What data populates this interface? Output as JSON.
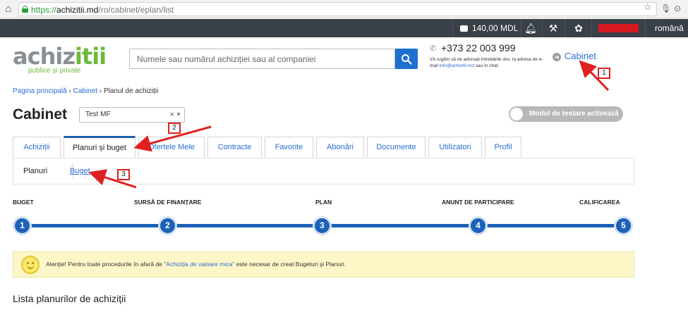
{
  "browser": {
    "url_scheme": "https://",
    "url_host": "achizitii.md",
    "url_path": "/ro/cabinet/eplan/list"
  },
  "topbar": {
    "balance": "140,00 MDL",
    "language": "română",
    "bg_color": "#3a4047"
  },
  "header": {
    "logo_part1": "achiz",
    "logo_part2": "itii",
    "logo_tagline": "publice și private",
    "search_placeholder": "Numele sau numărul achiziției sau al companiei",
    "phone": "+373 22 003 999",
    "contact_note_1": "Vă rugăm să ne adresați întrebările dvs. la adresa de e-mail ",
    "contact_email": "info@achizitii.md",
    "contact_note_2": " sau în chat.",
    "cabinet_link": "Cabinet"
  },
  "breadcrumb": {
    "home": "Pagina principală",
    "cabinet": "Cabinet",
    "current": "Planul de achiziții"
  },
  "page": {
    "title": "Cabinet",
    "account": "Test MF",
    "test_mode_toggle": "Modul de testare activează",
    "list_title": "Lista planurilor de achiziții"
  },
  "tabs": [
    {
      "label": "Achiziții"
    },
    {
      "label": "Planuri și buget",
      "active": true
    },
    {
      "label": "Ofertele Mele"
    },
    {
      "label": "Contracte"
    },
    {
      "label": "Favorite"
    },
    {
      "label": "Abonări"
    },
    {
      "label": "Documente"
    },
    {
      "label": "Utilizatori"
    },
    {
      "label": "Profil"
    }
  ],
  "subtabs": {
    "planuri": "Planuri",
    "buget": "Buget"
  },
  "steps": [
    {
      "label": "BUGET",
      "number": "1"
    },
    {
      "label": "SURSĂ DE FINANȚARE",
      "number": "2"
    },
    {
      "label": "PLAN",
      "number": "3"
    },
    {
      "label": "ANUNȚ DE PARTICIPARE",
      "number": "4"
    },
    {
      "label": "CALIFICAREA",
      "number": "5"
    }
  ],
  "notice": {
    "text_before": "Atenție! Pentru toate procedurile în afară de ",
    "link": "\"Achiziția de valoare mica\"",
    "text_after": " este necesar de creat Bugeturi și Planuri."
  },
  "annotations": {
    "callout_1": "1",
    "callout_2": "2",
    "callout_3": "3",
    "color": "#e02020"
  }
}
